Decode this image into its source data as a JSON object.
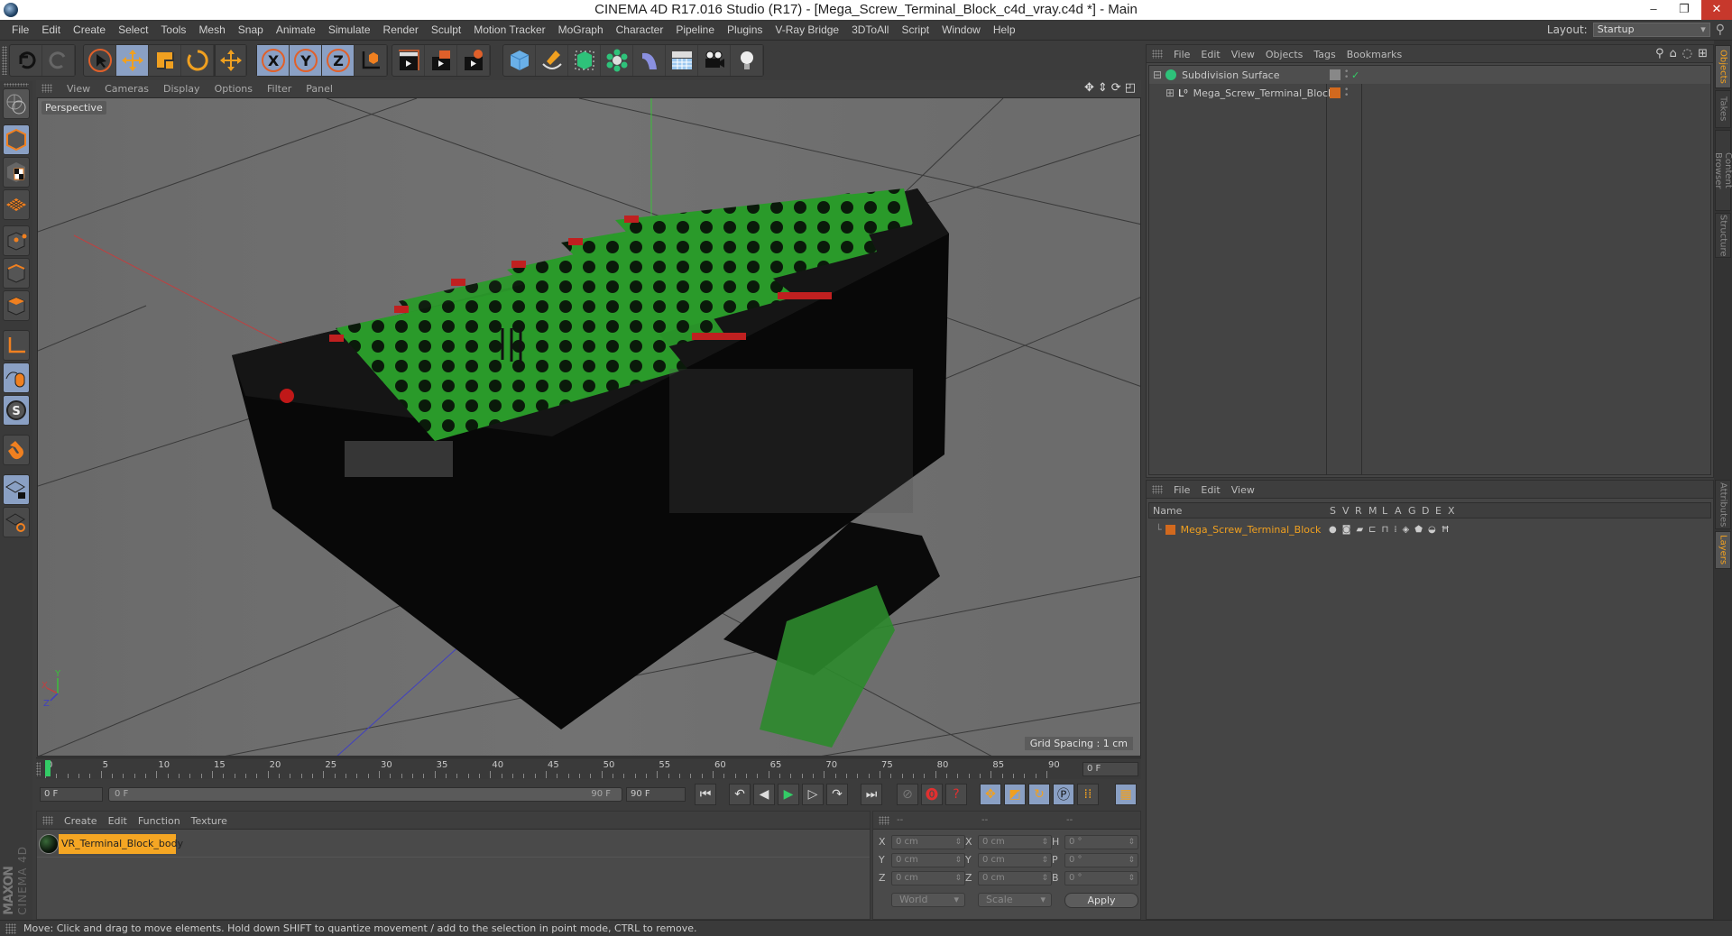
{
  "window": {
    "title": "CINEMA 4D R17.016 Studio (R17) - [Mega_Screw_Terminal_Block_c4d_vray.c4d *] - Main",
    "minimize": "–",
    "restore": "❐",
    "close": "✕"
  },
  "menubar": {
    "items": [
      "File",
      "Edit",
      "Create",
      "Select",
      "Tools",
      "Mesh",
      "Snap",
      "Animate",
      "Simulate",
      "Render",
      "Sculpt",
      "Motion Tracker",
      "MoGraph",
      "Character",
      "Pipeline",
      "Plugins",
      "V-Ray Bridge",
      "3DToAll",
      "Script",
      "Window",
      "Help"
    ],
    "layout_label": "Layout:",
    "layout_value": "Startup"
  },
  "toolbar": {
    "undo": "undo-icon",
    "redo": "redo-icon",
    "tools": [
      "select",
      "move",
      "scale",
      "rotate",
      "last-tool"
    ],
    "axes": [
      "X",
      "Y",
      "Z"
    ],
    "coord_system": "world-coordinates",
    "render": [
      "render-view",
      "render-picture-viewer",
      "edit-render-settings"
    ],
    "create": [
      "cube",
      "pen",
      "subdivision-surface",
      "array",
      "deformer",
      "floor",
      "camera",
      "light"
    ]
  },
  "left_tools": [
    "make-editable",
    "model-mode",
    "texture-mode",
    "workplane-mode",
    "points-mode",
    "edges-mode",
    "polygons-mode",
    "enable-axis",
    "tweak-mode",
    "solo-mode",
    "snap",
    "lock-workplane",
    "planar-workplane"
  ],
  "viewport": {
    "menu": [
      "View",
      "Cameras",
      "Display",
      "Options",
      "Filter",
      "Panel"
    ],
    "camera_label": "Perspective",
    "grid_spacing": "Grid Spacing : 1 cm",
    "axis_labels": {
      "x": "X",
      "y": "Y",
      "z": "Z"
    }
  },
  "timeline": {
    "ticks": [
      0,
      5,
      10,
      15,
      20,
      25,
      30,
      35,
      40,
      45,
      50,
      55,
      60,
      65,
      70,
      75,
      80,
      85,
      90
    ],
    "current_frame": "0 F",
    "start_field": "0 F",
    "range_start": "0 F",
    "range_end": "90 F",
    "end_field": "90 F",
    "range_max": 90
  },
  "material_panel": {
    "menu": [
      "Create",
      "Edit",
      "Function",
      "Texture"
    ],
    "materials": [
      {
        "name": "VR_Terminal_Block_body",
        "selected": true
      }
    ],
    "brand_top": "MAXON",
    "brand_bottom": "CINEMA 4D"
  },
  "coordinates": {
    "headers": [
      "--",
      "--",
      "--"
    ],
    "rows": [
      {
        "pos_label": "X",
        "pos": "0 cm",
        "size_label": "X",
        "size": "0 cm",
        "rot_label": "H",
        "rot": "0 °"
      },
      {
        "pos_label": "Y",
        "pos": "0 cm",
        "size_label": "Y",
        "size": "0 cm",
        "rot_label": "P",
        "rot": "0 °"
      },
      {
        "pos_label": "Z",
        "pos": "0 cm",
        "size_label": "Z",
        "size": "0 cm",
        "rot_label": "B",
        "rot": "0 °"
      }
    ],
    "space": "World",
    "mode": "Scale",
    "apply": "Apply"
  },
  "object_manager": {
    "menu": [
      "File",
      "Edit",
      "View",
      "Objects",
      "Tags",
      "Bookmarks"
    ],
    "objects": [
      {
        "name": "Subdivision Surface",
        "expand": "⊟",
        "enabled": "✓"
      },
      {
        "name": "Mega_Screw_Terminal_Block",
        "expand": "⊞",
        "tag_color": "#d2691e"
      }
    ]
  },
  "layer_manager": {
    "menu": [
      "File",
      "Edit",
      "View"
    ],
    "columns": [
      "Name",
      "S",
      "V",
      "R",
      "M",
      "L",
      "A",
      "G",
      "D",
      "E",
      "X"
    ],
    "layers": [
      {
        "name": "Mega_Screw_Terminal_Block",
        "color": "#d2691e"
      }
    ]
  },
  "side_tabs": {
    "top": [
      {
        "label": "Objects",
        "active": true
      },
      {
        "label": "Takes",
        "active": false
      },
      {
        "label": "Content Browser",
        "active": false
      },
      {
        "label": "Structure",
        "active": false
      }
    ],
    "bottom": [
      {
        "label": "Attributes",
        "active": false
      },
      {
        "label": "Layers",
        "active": true
      }
    ]
  },
  "status": "Move: Click and drag to move elements. Hold down SHIFT to quantize movement / add to the selection in point mode, CTRL to remove.",
  "colors": {
    "accent": "#f0a020",
    "active_button": "#8aa0c4",
    "model_green": "#2c9a2c",
    "model_black": "#0a0a0a"
  }
}
